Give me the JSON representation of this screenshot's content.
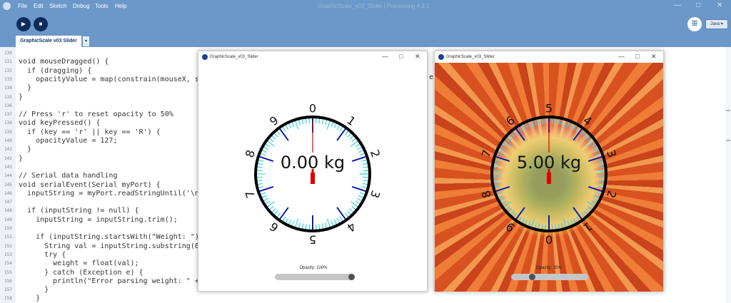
{
  "menubar": {
    "items": [
      "File",
      "Edit",
      "Sketch",
      "Debug",
      "Tools",
      "Help"
    ],
    "ghost_title": "GraphicScale_v03_Slider | Processing 4.3.1"
  },
  "toolbar": {
    "run_icon": "play-icon",
    "stop_icon": "stop-icon",
    "debugger_icon": "butterfly-icon",
    "mode_label": "Java ▾"
  },
  "tab": {
    "name": "GraphicScale v03 Slider",
    "menu_glyph": "▾"
  },
  "editor": {
    "lines": [
      {
        "n": "130",
        "text": ""
      },
      {
        "n": "131",
        "text": "void mouseDragged() {"
      },
      {
        "n": "132",
        "text": "  if (dragging) {"
      },
      {
        "n": "133",
        "text": "    opacityValue = map(constrain(mouseX, sl"
      },
      {
        "n": "134",
        "text": "  }"
      },
      {
        "n": "135",
        "text": "}"
      },
      {
        "n": "136",
        "text": ""
      },
      {
        "n": "137",
        "text": "// Press 'r' to reset opacity to 50%"
      },
      {
        "n": "138",
        "text": "void keyPressed() {"
      },
      {
        "n": "139",
        "text": "  if (key == 'r' || key == 'R') {"
      },
      {
        "n": "140",
        "text": "    opacityValue = 127;"
      },
      {
        "n": "141",
        "text": "  }"
      },
      {
        "n": "142",
        "text": "}"
      },
      {
        "n": "143",
        "text": ""
      },
      {
        "n": "144",
        "text": "// Serial data handling"
      },
      {
        "n": "145",
        "text": "void serialEvent(Serial myPort) {"
      },
      {
        "n": "146",
        "text": "  inputString = myPort.readStringUntil('\\n'"
      },
      {
        "n": "147",
        "text": ""
      },
      {
        "n": "148",
        "text": "  if (inputString != null) {"
      },
      {
        "n": "149",
        "text": "    inputString = inputString.trim();"
      },
      {
        "n": "150",
        "text": ""
      },
      {
        "n": "151",
        "text": "    if (inputString.startsWith(\"Weight: \")"
      },
      {
        "n": "152",
        "text": "      String val = inputString.substring(8,"
      },
      {
        "n": "153",
        "text": "      try {"
      },
      {
        "n": "154",
        "text": "        weight = float(val);"
      },
      {
        "n": "155",
        "text": "      } catch (Exception e) {"
      },
      {
        "n": "156",
        "text": "        println(\"Error parsing weight: \" +"
      },
      {
        "n": "157",
        "text": "      }"
      },
      {
        "n": "158",
        "text": "    }"
      }
    ],
    "overflow_glyph": "e"
  },
  "windows": [
    {
      "title": "GraphicScale_v03_Slider",
      "weight_text": "0.00 kg",
      "opacity_text": "Opacity: 100%",
      "slider_fraction": 1.0,
      "background": "white",
      "dial_numbers": [
        "0",
        "1",
        "2",
        "3",
        "4",
        "5",
        "6",
        "7",
        "8",
        "9"
      ]
    },
    {
      "title": "GraphicScale_v03_Slider",
      "weight_text": "5.00 kg",
      "opacity_text": "Opacity: 25%",
      "slider_fraction": 0.25,
      "background": "flower",
      "dial_numbers": [
        "5",
        "4",
        "3",
        "2",
        "1",
        "0",
        "9",
        "8",
        "7",
        "6"
      ]
    }
  ],
  "window_controls": [
    "—",
    "□",
    "✕"
  ],
  "colors": {
    "menubar_bg": "#6b98c9",
    "dial_ring": "#000000",
    "major_tick": "#0b1fa8",
    "minor_tick": "#46d3e6",
    "needle": "#e00000"
  }
}
